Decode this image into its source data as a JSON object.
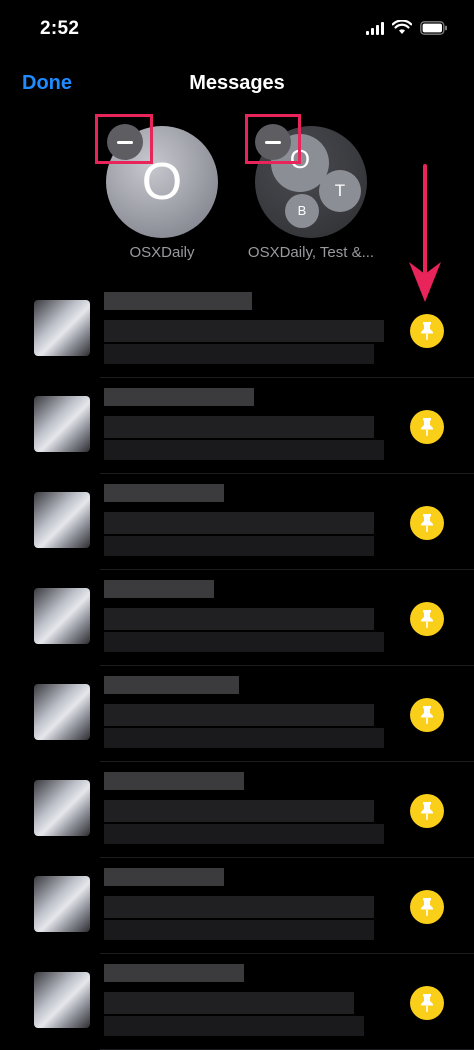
{
  "status_bar": {
    "time": "2:52"
  },
  "nav": {
    "done_label": "Done",
    "title": "Messages"
  },
  "pinned": [
    {
      "name": "OSXDaily",
      "initial": "O"
    },
    {
      "name": "OSXDaily, Test &...",
      "initials": [
        "O",
        "T",
        "B"
      ]
    }
  ],
  "colors": {
    "accent": "#1f8bff",
    "pin": "#f9cf1a",
    "highlight": "#e8245a"
  },
  "rows": [
    {
      "pin_icon": "pin-icon"
    },
    {
      "pin_icon": "pin-icon"
    },
    {
      "pin_icon": "pin-icon"
    },
    {
      "pin_icon": "pin-icon"
    },
    {
      "pin_icon": "pin-icon"
    },
    {
      "pin_icon": "pin-icon"
    },
    {
      "pin_icon": "pin-icon"
    },
    {
      "pin_icon": "pin-icon"
    }
  ]
}
